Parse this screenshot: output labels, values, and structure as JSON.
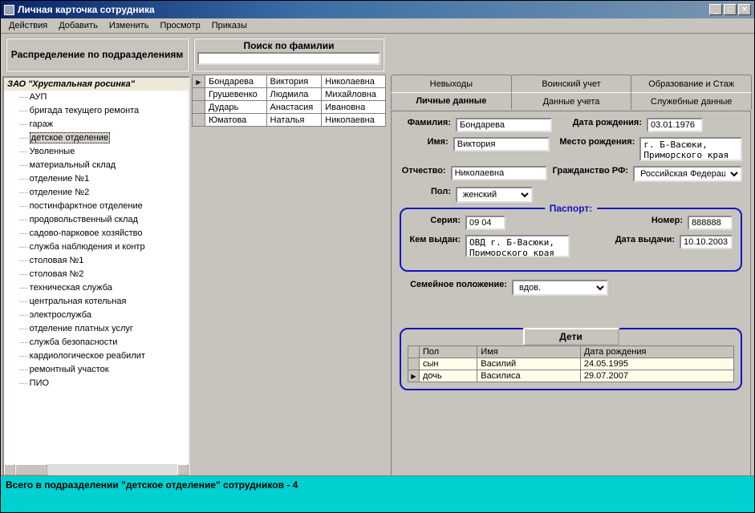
{
  "window": {
    "title": "Личная карточка сотрудника"
  },
  "menu": [
    "Действия",
    "Добавить",
    "Изменить",
    "Просмотр",
    "Приказы"
  ],
  "tree": {
    "header": "Распределение по подразделениям",
    "root": "ЗАО \"Хрустальная росинка\"",
    "selected": "детское отделение",
    "items": [
      "АУП",
      "бригада текущего ремонта",
      "гараж",
      "детское отделение",
      "Уволенные",
      "материальный склад",
      "отделение №1",
      "отделение №2",
      "постинфарктное отделение",
      "продовольственный склад",
      "садово-парковое хозяйство",
      "служба наблюдения и контр",
      "столовая №1",
      "столовая №2",
      "техническая служба",
      "центральная котельная",
      "электрослужба",
      "отделение платных услуг",
      "служба безопасности",
      "кардиологическое реабилит",
      "ремонтный участок",
      "ПИО"
    ]
  },
  "search": {
    "header": "Поиск по фамилии",
    "value": ""
  },
  "list": {
    "rows": [
      {
        "sel": true,
        "c0": "Бондарева",
        "c1": "Виктория",
        "c2": "Николаевна"
      },
      {
        "sel": false,
        "c0": "Грушевенко",
        "c1": "Людмила",
        "c2": "Михайловна"
      },
      {
        "sel": false,
        "c0": "Дударь",
        "c1": "Анастасия",
        "c2": "Ивановна"
      },
      {
        "sel": false,
        "c0": "Юматова",
        "c1": "Наталья",
        "c2": "Николаевна"
      }
    ]
  },
  "tabs": {
    "row1": [
      "Невыходы",
      "Воинский учет",
      "Образование и Стаж"
    ],
    "row2": [
      "Личные данные",
      "Данные учета",
      "Служебные данные"
    ],
    "active": "Личные данные"
  },
  "form": {
    "labels": {
      "lastname": "Фамилия:",
      "firstname": "Имя:",
      "patronymic": "Отчество:",
      "dob": "Дата рождения:",
      "pob": "Место рождения:",
      "citizenship": "Гражданство РФ:",
      "sex": "Пол:",
      "marital": "Семейное положение:"
    },
    "lastname": "Бондарева",
    "firstname": "Виктория",
    "patronymic": "Николаевна",
    "dob": "03.01.1976",
    "pob": "г. Б-Васюки, Приморского края",
    "citizenship": "Российская Федерация",
    "sex": "женский",
    "marital": "вдов."
  },
  "passport": {
    "legend": "Паспорт:",
    "labels": {
      "series": "Серия:",
      "number": "Номер:",
      "issued_by": "Кем выдан:",
      "issue_date": "Дата выдачи:"
    },
    "series": "09 04",
    "number": "888888",
    "issued_by": "ОВД г. Б-Васюки, Приморского края",
    "issue_date": "10.10.2003"
  },
  "children": {
    "button": "Дети",
    "headers": {
      "sex": "Пол",
      "name": "Имя",
      "dob": "Дата рождения"
    },
    "rows": [
      {
        "sel": false,
        "sex": "сын",
        "name": "Василий",
        "dob": "24.05.1995"
      },
      {
        "sel": true,
        "sex": "дочь",
        "name": "Василиса",
        "dob": "29.07.2007"
      }
    ]
  },
  "status": "Всего в подразделении \"детское отделение\" сотрудников - 4"
}
